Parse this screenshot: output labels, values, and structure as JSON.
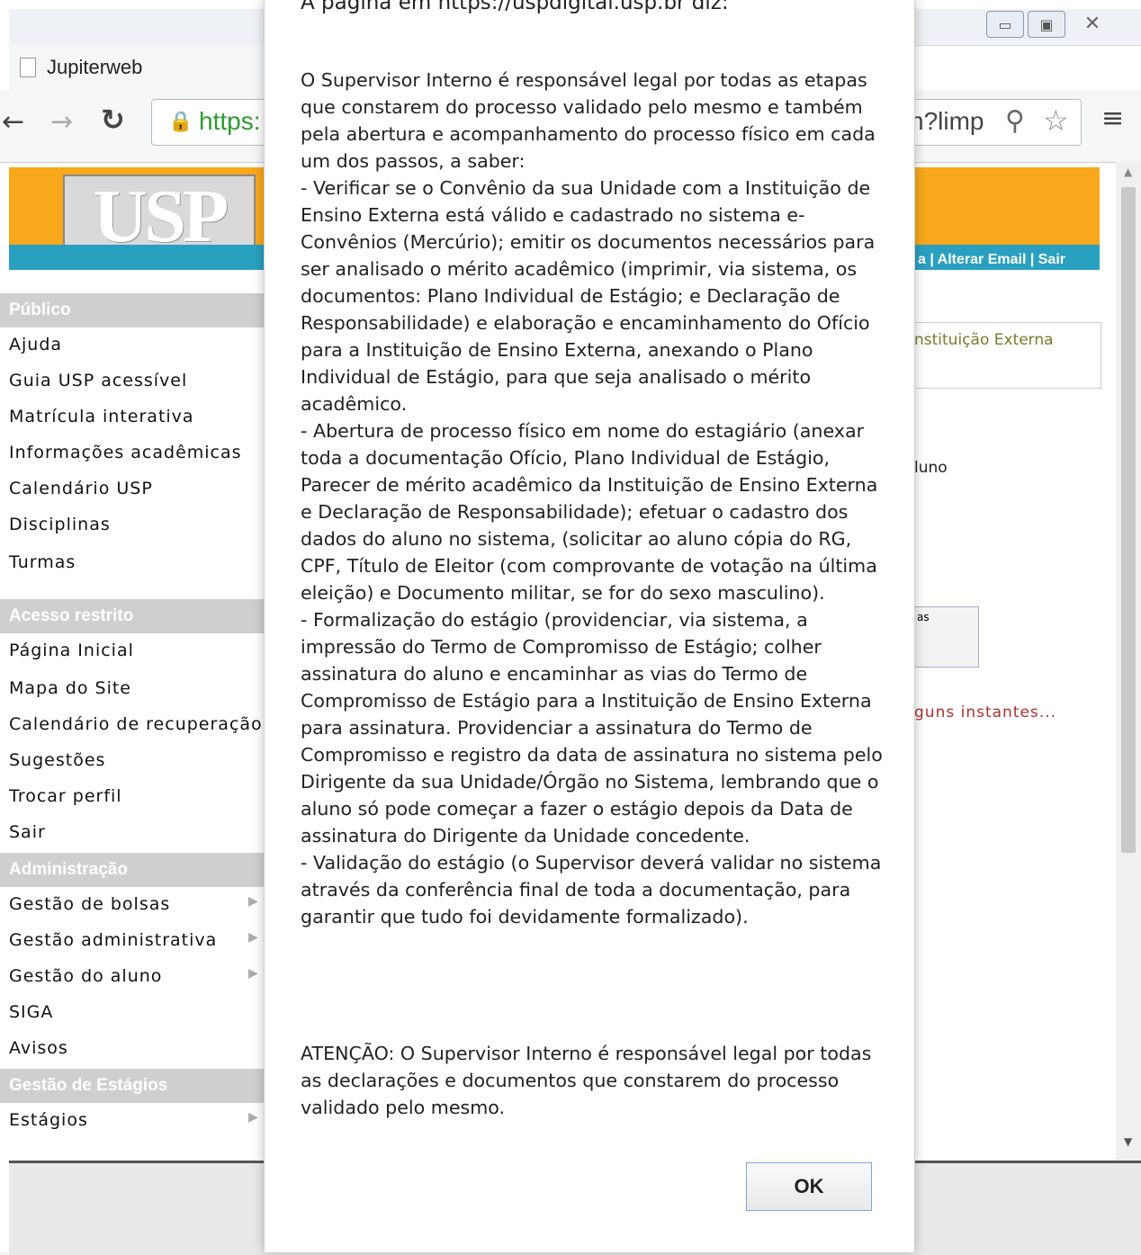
{
  "browser": {
    "tab_title": "Jupiterweb",
    "url_left": "https:",
    "url_right": "n?limp"
  },
  "banner": {
    "logo_text": "USP",
    "top_links": "a | Alterar Email | Sair"
  },
  "sidebar": {
    "sections": [
      {
        "title": "Público",
        "items": [
          {
            "label": "Ajuda"
          },
          {
            "label": "Guia USP acessível"
          },
          {
            "label": "Matrícula interativa"
          },
          {
            "label": "Informações acadêmicas"
          },
          {
            "label": "Calendário USP"
          },
          {
            "label": "Disciplinas"
          },
          {
            "label": "Turmas"
          }
        ]
      },
      {
        "title": "Acesso restrito",
        "items": [
          {
            "label": "Página Inicial"
          },
          {
            "label": "Mapa do Site"
          },
          {
            "label": "Calendário de recuperação"
          },
          {
            "label": "Sugestões"
          },
          {
            "label": "Trocar perfil"
          },
          {
            "label": "Sair"
          }
        ]
      },
      {
        "title": "Administração",
        "items": [
          {
            "label": "Gestão de bolsas"
          },
          {
            "label": "Gestão administrativa"
          },
          {
            "label": "Gestão do aluno"
          },
          {
            "label": "SIGA"
          },
          {
            "label": "Avisos"
          }
        ]
      },
      {
        "title": "Gestão de Estágios",
        "items": [
          {
            "label": "Estágios"
          }
        ]
      }
    ]
  },
  "background_content": {
    "institution_label": "nstituição Externa",
    "aluno_label": "luno",
    "box_label": "as",
    "loading_text": "guns instantes..."
  },
  "dialog": {
    "header": "A página em https://uspdigital.usp.br diz:",
    "body": "O Supervisor Interno é responsável legal por todas as etapas que constarem do processo validado pelo mesmo e também pela abertura e acompanhamento do processo físico em cada um dos passos, a saber:\n- Verificar se o Convênio da sua Unidade com a Instituição de Ensino Externa está válido e cadastrado no sistema e-Convênios (Mercúrio); emitir os documentos necessários para ser analisado o mérito acadêmico (imprimir, via sistema, os documentos: Plano Individual de Estágio; e Declaração de Responsabilidade) e elaboração e encaminhamento do Ofício para a Instituição de Ensino Externa, anexando o Plano Individual de Estágio, para que seja analisado o mérito acadêmico.\n- Abertura de processo físico em nome do estagiário (anexar toda a documentação Ofício, Plano Individual de Estágio, Parecer de mérito acadêmico da Instituição de Ensino Externa e Declaração de Responsabilidade); efetuar o cadastro dos dados do aluno no sistema, (solicitar ao aluno cópia do RG, CPF, Título de Eleitor (com comprovante de votação na última eleição) e Documento militar, se for do sexo masculino).\n- Formalização do estágio (providenciar, via sistema, a impressão do Termo de Compromisso de Estágio; colher assinatura do aluno e encaminhar as vias do Termo de Compromisso de Estágio para a Instituição de Ensino Externa para assinatura. Providenciar a assinatura do Termo de Compromisso e registro da data de assinatura no sistema pelo Dirigente da sua Unidade/Órgão no Sistema, lembrando que o aluno só pode começar a fazer o estágio depois da Data de assinatura do Dirigente da Unidade concedente.\n- Validação do estágio (o Supervisor deverá validar no sistema através da conferência final de toda a documentação, para garantir que tudo foi devidamente formalizado).",
    "attention": "ATENÇÃO: O Supervisor Interno é responsável legal por todas as declarações e documentos que constarem do processo validado pelo mesmo.",
    "ok_label": "OK"
  }
}
